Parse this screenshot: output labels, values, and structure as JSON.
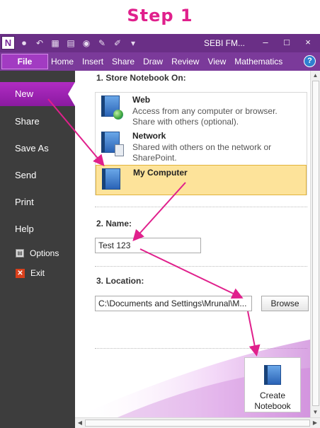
{
  "banner": {
    "text": "Step 1"
  },
  "window": {
    "title": "SEBI FM...",
    "app_icon_letter": "N",
    "minimize": "–",
    "maximize": "□",
    "close": "×"
  },
  "ribbon": {
    "file_tab": "File",
    "tabs": [
      "Home",
      "Insert",
      "Share",
      "Draw",
      "Review",
      "View",
      "Mathematics"
    ],
    "help": "?"
  },
  "sidebar": {
    "items": [
      {
        "label": "New",
        "active": true
      },
      {
        "label": "Share"
      },
      {
        "label": "Save As"
      },
      {
        "label": "Send"
      },
      {
        "label": "Print"
      },
      {
        "label": "Help"
      }
    ],
    "options_label": "Options",
    "exit_label": "Exit"
  },
  "store": {
    "title": "1. Store Notebook On:",
    "items": [
      {
        "name": "Web",
        "description": "Access from any computer or browser. Share with others (optional)."
      },
      {
        "name": "Network",
        "description": "Shared with others on the network or SharePoint."
      },
      {
        "name": "My Computer",
        "description": "",
        "selected": true
      }
    ]
  },
  "name_section": {
    "title": "2. Name:",
    "value": "Test 123"
  },
  "location_section": {
    "title": "3. Location:",
    "value": "C:\\Documents and Settings\\Mrunal\\M...",
    "browse_label": "Browse"
  },
  "create": {
    "label_line1": "Create",
    "label_line2": "Notebook"
  },
  "colors": {
    "accent_purple": "#7b3a9a",
    "annotation_pink": "#e0208c",
    "selected_bg": "#fde39a",
    "sidebar_bg": "#3d3d3d"
  },
  "icons": [
    "qat-save-icon",
    "qat-undo-icon",
    "qat-page-icon",
    "notebook-icon",
    "globe-icon",
    "server-icon",
    "options-icon",
    "exit-icon",
    "help-icon"
  ]
}
